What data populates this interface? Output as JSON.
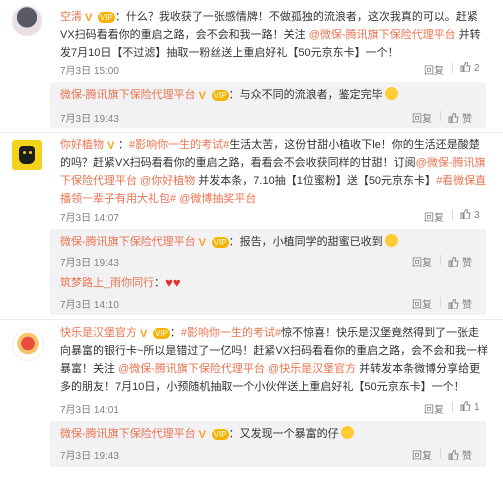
{
  "comments": [
    {
      "author": "空清",
      "text_segments": [
        "：什么？我收获了一张感情牌！不做孤独的流浪者，这次我真的可以。赶紧VX扫码看看你的重启之路，会不会和我一路！关注 ",
        "@微保-腾讯旗下保险代理平台",
        " 并转发7月10日【不过滤】抽取一粉丝送上重启好礼【50元京东卡】一个！"
      ],
      "time": "7月3日 15:00",
      "reply_label": "回复",
      "like_count": "2",
      "replies": [
        {
          "author": "微保-腾讯旗下保险代理平台",
          "text": "：与众不同的流浪者，鉴定完毕",
          "time": "7月3日 19:43",
          "reply_label": "回复",
          "like_label": "赞"
        }
      ]
    },
    {
      "author": "你好植物",
      "text_segments": [
        "：",
        "#影响你一生的考试#",
        "生活太苦，这份甘甜小植收下le！你的生活还是酸楚的吗？赶紧VX扫码看看你的重启之路，看看会不会收获同样的甘甜！订阅",
        "@微保-腾讯旗下保险代理平台 @你好植物",
        " 并发本条，7.10抽【1位蜜粉】送【50元京东卡】",
        "#看微保直播领一辈子有用大礼包#",
        " ",
        "@微博抽奖平台"
      ],
      "time": "7月3日 14:07",
      "reply_label": "回复",
      "like_count": "3",
      "replies": [
        {
          "author": "微保-腾讯旗下保险代理平台",
          "text": "：报告，小植同学的甜蜜已收到",
          "time": "7月3日 19:43",
          "reply_label": "回复",
          "like_label": "赞"
        },
        {
          "author": "筑梦路上_雨你同行",
          "text": "：",
          "time": "7月3日 14:10",
          "reply_label": "回复",
          "like_label": "赞"
        }
      ]
    },
    {
      "author": "快乐是汉堡官方",
      "text_segments": [
        "：",
        "#影响你一生的考试#",
        "惊不惊喜！快乐是汉堡竟然得到了一张走向暴富的银行卡~所以是错过了一亿吗！赶紧VX扫码看看你的重启之路，会不会和我一样暴富！关注 ",
        "@微保-腾讯旗下保险代理平台 @快乐是汉堡官方",
        " 并转发本条微博分享给更多的朋友！7月10日，小预随机抽取一个小伙伴送上重启好礼【50元京东卡】一个！"
      ],
      "time": "7月3日 14:01",
      "reply_label": "回复",
      "like_count": "1",
      "replies": [
        {
          "author": "微保-腾讯旗下保险代理平台",
          "text": "：又发现一个暴富的仔",
          "time": "7月3日 19:43",
          "reply_label": "回复",
          "like_label": "赞"
        }
      ]
    }
  ],
  "colors": {
    "link": "#eb7350",
    "meta": "#808080",
    "reply_bg": "#f2f2f5"
  }
}
